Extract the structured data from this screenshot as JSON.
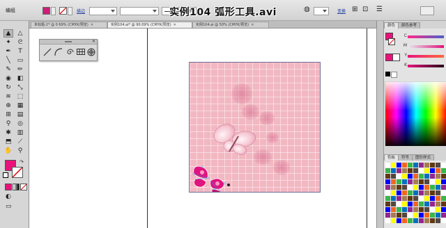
{
  "control_bar": {
    "mode_label": "编组",
    "stroke_size_value": "",
    "stroke_style_label": "基本",
    "style_dd_value": "",
    "opacity_label": "描边",
    "transform_label": "变换",
    "fill_color": "#cc1f7a",
    "video_title": "实例104 弧形工具.avi"
  },
  "tabs": [
    {
      "label": "未标题-2* @ 0 69% (CMYK/预览)",
      "active": false
    },
    {
      "label": "实例104.ai* @ 90.09% (CMYK/预览)",
      "active": true
    },
    {
      "label": "实例104.ai @ 50% (CMYK/预览)",
      "active": false
    }
  ],
  "toolbox": {
    "tools": [
      {
        "name": "selection-tool",
        "glyph": "▲"
      },
      {
        "name": "direct-selection-tool",
        "glyph": "△"
      },
      {
        "name": "magic-wand-tool",
        "glyph": "✦"
      },
      {
        "name": "lasso-tool",
        "glyph": "ᘓ"
      },
      {
        "name": "pen-tool",
        "glyph": "✒"
      },
      {
        "name": "type-tool",
        "glyph": "T"
      },
      {
        "name": "line-tool",
        "glyph": "╲"
      },
      {
        "name": "rectangle-tool",
        "glyph": "▭"
      },
      {
        "name": "paintbrush-tool",
        "glyph": "✎"
      },
      {
        "name": "pencil-tool",
        "glyph": "✏"
      },
      {
        "name": "blob-brush-tool",
        "glyph": "◉"
      },
      {
        "name": "eraser-tool",
        "glyph": "◧"
      },
      {
        "name": "rotate-tool",
        "glyph": "↻"
      },
      {
        "name": "scale-tool",
        "glyph": "⤡"
      },
      {
        "name": "width-tool",
        "glyph": "≋"
      },
      {
        "name": "free-transform-tool",
        "glyph": "⬚"
      },
      {
        "name": "shape-builder-tool",
        "glyph": "⊕"
      },
      {
        "name": "perspective-grid-tool",
        "glyph": "▦"
      },
      {
        "name": "mesh-tool",
        "glyph": "⊞"
      },
      {
        "name": "gradient-tool",
        "glyph": "▤"
      },
      {
        "name": "eyedropper-tool",
        "glyph": "⚲"
      },
      {
        "name": "blend-tool",
        "glyph": "◎"
      },
      {
        "name": "symbol-sprayer-tool",
        "glyph": "✱"
      },
      {
        "name": "column-graph-tool",
        "glyph": "▥"
      },
      {
        "name": "artboard-tool",
        "glyph": "⬒"
      },
      {
        "name": "slice-tool",
        "glyph": "⟋"
      },
      {
        "name": "hand-tool",
        "glyph": "✋"
      },
      {
        "name": "zoom-tool",
        "glyph": "⚲"
      }
    ],
    "fill_color": "#e8137a"
  },
  "arc_panel": {
    "tools": [
      {
        "name": "line-segment-tool",
        "glyph": "╱"
      },
      {
        "name": "arc-tool",
        "glyph": "⌒"
      },
      {
        "name": "spiral-tool",
        "glyph": "@"
      },
      {
        "name": "rectangular-grid-tool",
        "glyph": "▦"
      },
      {
        "name": "polar-grid-tool",
        "glyph": "⊛"
      }
    ]
  },
  "right_panel": {
    "color_tab": "颜色",
    "color_guide_tab": "颜色参考",
    "sliders": [
      {
        "label": "C",
        "value": 0.1
      },
      {
        "label": "M",
        "value": 0.88
      },
      {
        "label": "Y",
        "value": 0.12
      },
      {
        "label": "K",
        "value": 0.02
      }
    ],
    "swatches_tab": "色板",
    "symbols_tab": "符号",
    "graphic_styles_tab": "图形样式"
  },
  "colors": {
    "accent": "#e8137a",
    "artboard": "#f2b8c2",
    "butterfly_accent": "#e0147e"
  }
}
